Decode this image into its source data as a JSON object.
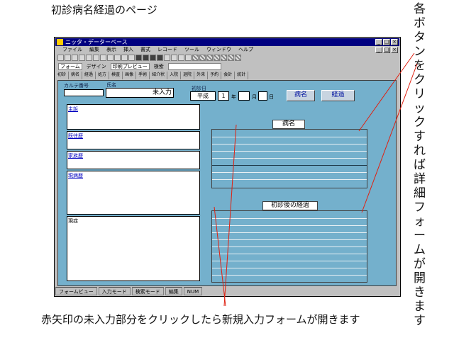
{
  "page_title": "初診病名経過のページ",
  "side_note": "各ボタンをクリックすれば詳細フォームが開きます",
  "bottom_note": "赤矢印の未入力部分をクリックしたら新規入力フォームが開きます",
  "window": {
    "title": "ニッタ・データーベース",
    "menu": [
      "ファイル",
      "編集",
      "表示",
      "挿入",
      "書式",
      "レコード",
      "ツール",
      "ウィンドウ",
      "ヘルプ"
    ],
    "toolbar2": {
      "tool_a": "フォーム",
      "tool_b": "デザイン",
      "tool_c": "印刷プレビュー",
      "tool_d": "検索"
    },
    "tabs": [
      "初診",
      "病名",
      "経過",
      "処方",
      "検査",
      "画像",
      "手術",
      "紹介状",
      "入院",
      "退院",
      "外来",
      "予約",
      "会計",
      "統計"
    ],
    "status": [
      "フォームビュー",
      "入力モード",
      "検索モード",
      "編集",
      "NUM"
    ]
  },
  "form": {
    "patient_id_label": "カルテ番号",
    "patient_id_value": "",
    "name_label": "氏名",
    "name_value": "未入力",
    "date_label": "初診日",
    "date_era": "平成",
    "date_year": "1",
    "date_year_unit": "年",
    "date_month": "",
    "date_month_unit": "月",
    "date_day": "",
    "date_day_unit": "日",
    "btn_a": "病名",
    "btn_b": "経過",
    "box1_label": "主訴",
    "box2_label": "既往歴",
    "box3_label": "家族歴",
    "box4_label": "現病歴",
    "box5_label": "現症",
    "grid1_title": "病名",
    "grid2_title": "初診後の経過"
  },
  "colors": {
    "form_bg": "#74b0cc",
    "arrow": "#e02010"
  }
}
